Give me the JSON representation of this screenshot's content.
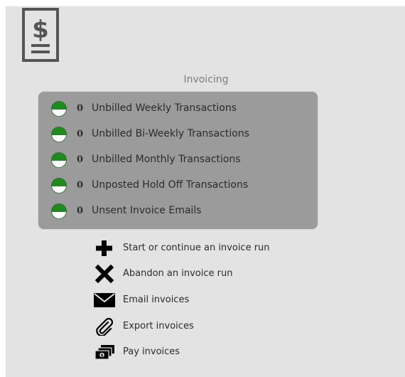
{
  "header": {
    "logo_icon": "dollar-invoice-icon"
  },
  "section": {
    "title": "Invoicing"
  },
  "status_items": [
    {
      "count": "0",
      "label": "Unbilled Weekly Transactions",
      "icon": "green-status-dot-icon"
    },
    {
      "count": "0",
      "label": "Unbilled Bi-Weekly Transactions",
      "icon": "green-status-dot-icon"
    },
    {
      "count": "0",
      "label": "Unbilled Monthly Transactions",
      "icon": "green-status-dot-icon"
    },
    {
      "count": "0",
      "label": "Unposted Hold Off Transactions",
      "icon": "green-status-dot-icon"
    },
    {
      "count": "0",
      "label": "Unsent Invoice Emails",
      "icon": "green-status-dot-icon"
    }
  ],
  "actions": [
    {
      "label": "Start or continue an invoice run",
      "icon": "plus-icon"
    },
    {
      "label": "Abandon an invoice run",
      "icon": "x-icon"
    },
    {
      "label": "Email invoices",
      "icon": "envelope-icon"
    },
    {
      "label": "Export invoices",
      "icon": "paperclip-icon"
    },
    {
      "label": "Pay invoices",
      "icon": "money-icon"
    }
  ],
  "colors": {
    "panel_bg": "#e3e3e3",
    "status_box_bg": "#9b9b9b",
    "status_green": "#1f8a1f",
    "text": "#2b2b2b"
  }
}
